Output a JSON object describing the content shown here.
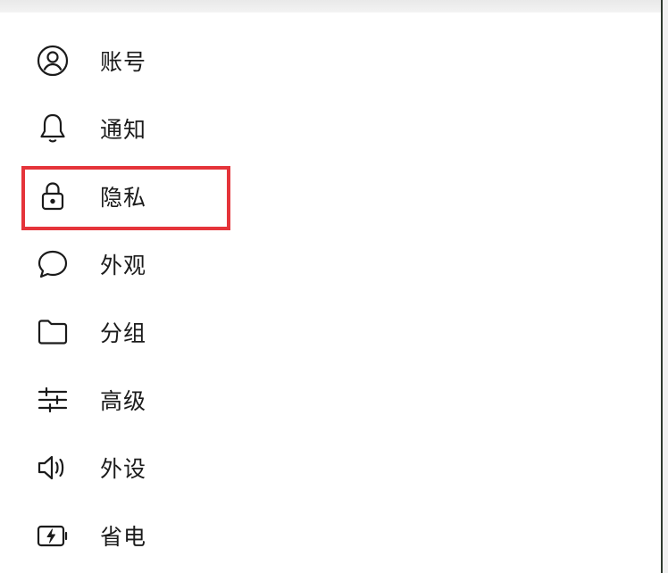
{
  "menu": {
    "items": [
      {
        "label": "账号",
        "icon": "account-circle-icon"
      },
      {
        "label": "通知",
        "icon": "bell-icon"
      },
      {
        "label": "隐私",
        "icon": "lock-icon"
      },
      {
        "label": "外观",
        "icon": "chat-bubble-icon"
      },
      {
        "label": "分组",
        "icon": "folder-icon"
      },
      {
        "label": "高级",
        "icon": "sliders-icon"
      },
      {
        "label": "外设",
        "icon": "speaker-icon"
      },
      {
        "label": "省电",
        "icon": "battery-charging-icon"
      }
    ]
  },
  "highlight": {
    "target": "隐私",
    "color": "#e5343a"
  },
  "colors": {
    "text": "#1b1b1b",
    "icon_stroke": "#1b1b1b",
    "background": "#ffffff"
  }
}
